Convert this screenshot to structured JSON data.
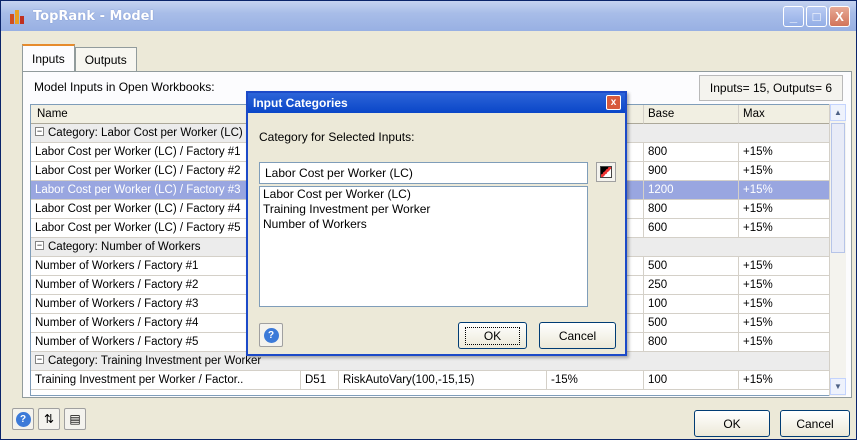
{
  "window": {
    "title": "TopRank - Model",
    "minimize": "_",
    "maximize": "□",
    "close": "X"
  },
  "tabs": [
    {
      "label": "Inputs",
      "active": true
    },
    {
      "label": "Outputs",
      "active": false
    }
  ],
  "model_inputs_label": "Model Inputs in Open Workbooks:",
  "counts_label": "Inputs= 15, Outputs= 6",
  "grid": {
    "headers": {
      "name": "Name",
      "base": "Base",
      "max": "Max"
    },
    "rows": [
      {
        "type": "cat",
        "name": "Category: Labor Cost per Worker (LC)"
      },
      {
        "type": "data",
        "name": "Labor Cost per Worker (LC) / Factory #1",
        "base": "800",
        "max": "+15%"
      },
      {
        "type": "data",
        "name": "Labor Cost per Worker (LC) / Factory #2",
        "base": "900",
        "max": "+15%"
      },
      {
        "type": "sel",
        "name": "Labor Cost per Worker (LC) / Factory #3",
        "base": "1200",
        "max": "+15%"
      },
      {
        "type": "data",
        "name": "Labor Cost per Worker (LC) / Factory #4",
        "base": "800",
        "max": "+15%"
      },
      {
        "type": "data",
        "name": "Labor Cost per Worker (LC) / Factory #5",
        "base": "600",
        "max": "+15%"
      },
      {
        "type": "cat",
        "name": "Category: Number of Workers"
      },
      {
        "type": "data",
        "name": "Number of Workers / Factory #1",
        "base": "500",
        "max": "+15%"
      },
      {
        "type": "data",
        "name": "Number of Workers / Factory #2",
        "base": "250",
        "max": "+15%"
      },
      {
        "type": "data",
        "name": "Number of Workers / Factory #3",
        "base": "100",
        "max": "+15%"
      },
      {
        "type": "data",
        "name": "Number of Workers / Factory #4",
        "base": "500",
        "max": "+15%"
      },
      {
        "type": "data",
        "name": "Number of Workers / Factory #5",
        "base": "800",
        "max": "+15%"
      },
      {
        "type": "cat",
        "name": "Category: Training Investment per Worker"
      },
      {
        "type": "data",
        "name": "Training Investment per Worker / Factor..",
        "cell": "D51",
        "func": "RiskAutoVary(100,-15,15)",
        "min": "-15%",
        "base": "100",
        "max": "+15%"
      }
    ]
  },
  "buttons": {
    "ok": "OK",
    "cancel": "Cancel"
  },
  "dialog": {
    "title": "Input Categories",
    "close": "x",
    "label": "Category for Selected Inputs:",
    "input_value": "Labor Cost per Worker (LC)",
    "options": [
      "Labor Cost per Worker (LC)",
      "Training Investment per Worker",
      "Number of Workers"
    ],
    "ok": "OK",
    "cancel": "Cancel",
    "help": "?"
  },
  "icons": {
    "help": "?",
    "sort": "⇅",
    "report": "▤"
  }
}
